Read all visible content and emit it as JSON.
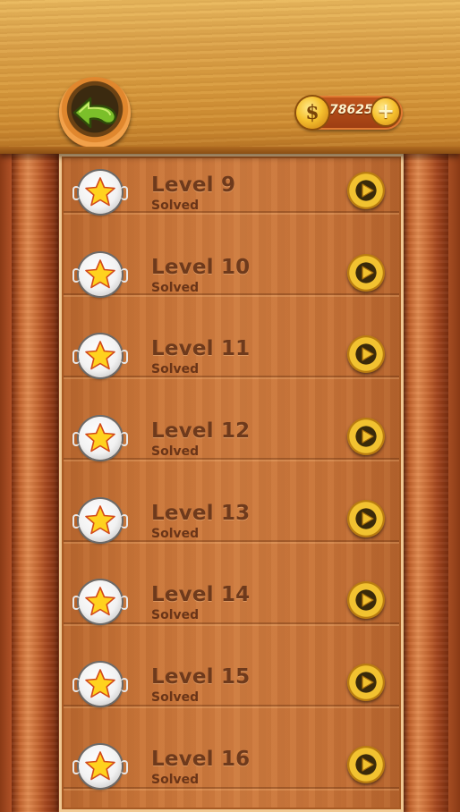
{
  "header": {
    "back_icon": "back-arrow-icon",
    "coins": {
      "icon": "dollar-coin-icon",
      "symbol": "$",
      "amount": "78625",
      "add_icon": "plus-icon",
      "add_symbol": "+"
    }
  },
  "levels": [
    {
      "title": "Level 9",
      "status": "Solved",
      "badge_icon": "star-icon",
      "action_icon": "play-icon"
    },
    {
      "title": "Level 10",
      "status": "Solved",
      "badge_icon": "star-icon",
      "action_icon": "play-icon"
    },
    {
      "title": "Level 11",
      "status": "Solved",
      "badge_icon": "star-icon",
      "action_icon": "play-icon"
    },
    {
      "title": "Level 12",
      "status": "Solved",
      "badge_icon": "star-icon",
      "action_icon": "play-icon"
    },
    {
      "title": "Level 13",
      "status": "Solved",
      "badge_icon": "star-icon",
      "action_icon": "play-icon"
    },
    {
      "title": "Level 14",
      "status": "Solved",
      "badge_icon": "star-icon",
      "action_icon": "play-icon"
    },
    {
      "title": "Level 15",
      "status": "Solved",
      "badge_icon": "star-icon",
      "action_icon": "play-icon"
    },
    {
      "title": "Level 16",
      "status": "Solved",
      "badge_icon": "star-icon",
      "action_icon": "play-icon"
    }
  ],
  "colors": {
    "header_wood": "#dca24a",
    "board_wood": "#c87438",
    "text_brown": "#6e3a1c",
    "back_arrow_green": "#7bbf2a",
    "coin_gold": "#f6c12e",
    "star_yellow": "#ffd21e"
  }
}
